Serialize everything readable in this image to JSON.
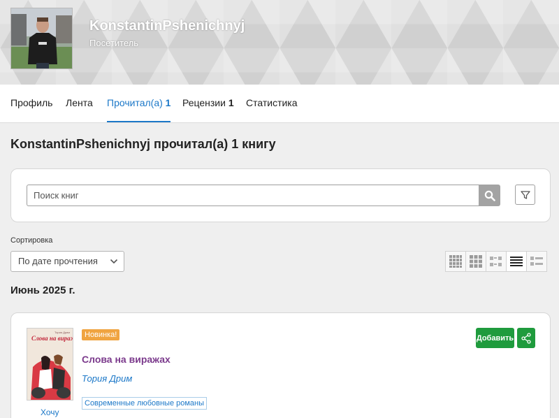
{
  "profile": {
    "username": "KonstantinPshenichnyj",
    "role": "Посетитель"
  },
  "tabs": [
    {
      "label": "Профиль",
      "count": ""
    },
    {
      "label": "Лента",
      "count": ""
    },
    {
      "label": "Прочитал(а)",
      "count": "1"
    },
    {
      "label": "Рецензии",
      "count": "1"
    },
    {
      "label": "Статистика",
      "count": ""
    }
  ],
  "active_tab": "Прочитал(а)",
  "page_title": "KonstantinPshenichnyj прочитал(а) 1 книгу",
  "search": {
    "placeholder": "Поиск книг",
    "value": ""
  },
  "sort": {
    "label": "Сортировка",
    "selected": "По дате прочтения"
  },
  "view_modes": [
    "grid-large-icon",
    "grid-medium-icon",
    "grid-small-icon",
    "list-icon",
    "list-detailed-icon"
  ],
  "active_view": "list-icon",
  "month_heading": "Июнь 2025 г.",
  "book": {
    "badge": "Новинка!",
    "title": "Слова на виражах",
    "author": "Тория Дрим",
    "genre": "Современные любовные романы",
    "want_label": "Хочу",
    "add_label": "Добавить",
    "cover_title": "Слова на виражах",
    "cover_author": "Тория Дрим"
  },
  "colors": {
    "accent": "#1c78c8",
    "title": "#7b3a8c",
    "badge": "#f0a440",
    "add_button": "#1f9b3d"
  }
}
